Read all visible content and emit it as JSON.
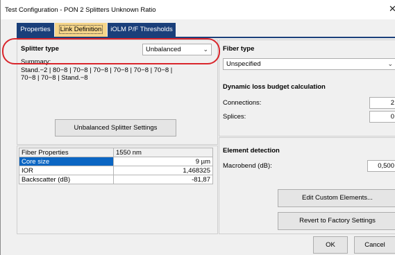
{
  "window": {
    "title": "Test Configuration - PON 2 Splitters Unknown Ratio",
    "close_glyph": "✕"
  },
  "tabs": [
    {
      "label": "Properties"
    },
    {
      "label": "Link Definition"
    },
    {
      "label": "iOLM P/F Thresholds"
    }
  ],
  "splitter": {
    "label": "Splitter type",
    "value": "Unbalanced",
    "summary_label": "Summary:",
    "summary_line1": "Stand.−2 | 80−8 | 70−8 | 70−8 | 70−8 | 70−8 | 70−8 |",
    "summary_line2": "70−8 | 70−8 | Stand.−8",
    "settings_button": "Unbalanced Splitter Settings"
  },
  "fiber_table": {
    "header": [
      "Fiber Properties",
      "1550 nm"
    ],
    "rows": [
      {
        "name": "Core size",
        "value": "9 µm"
      },
      {
        "name": "IOR",
        "value": "1,468325"
      },
      {
        "name": "Backscatter (dB)",
        "value": "-81,87"
      }
    ]
  },
  "fiber_type": {
    "label": "Fiber type",
    "value": "Unspecified"
  },
  "loss_budget": {
    "heading": "Dynamic loss budget calculation",
    "connections_label": "Connections:",
    "connections_value": "2",
    "splices_label": "Splices:",
    "splices_value": "0"
  },
  "element_detection": {
    "heading": "Element detection",
    "macrobend_label": "Macrobend (dB):",
    "macrobend_value": "0,500"
  },
  "buttons": {
    "edit_custom": "Edit Custom Elements...",
    "revert": "Revert to Factory Settings",
    "ok": "OK",
    "cancel": "Cancel"
  },
  "colors": {
    "tab_bg": "#1a3f7a",
    "active_tab_bg": "#f5d58a",
    "highlight_circle": "#d9252b",
    "selection": "#0b66c3"
  },
  "icons": {
    "combo_chevron": "chevron-down-icon",
    "close": "close-icon"
  }
}
